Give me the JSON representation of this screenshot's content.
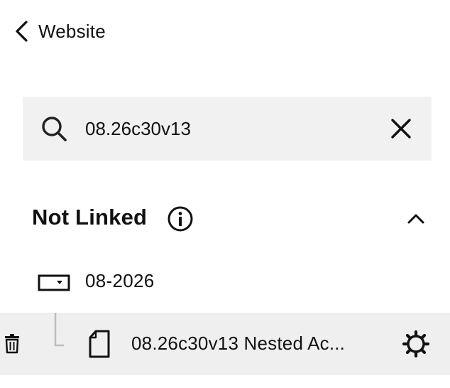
{
  "header": {
    "back_label": "Website"
  },
  "search": {
    "value": "08.26c30v13"
  },
  "section": {
    "title": "Not Linked"
  },
  "tree": {
    "folder": {
      "label": "08-2026"
    },
    "page": {
      "label": "08.26c30v13 Nested Ac..."
    }
  },
  "icons": {
    "back": "chevron-left-icon",
    "search": "search-icon",
    "clear": "close-icon",
    "info": "info-icon",
    "collapse": "chevron-up-icon",
    "folder": "folder-dropdown-icon",
    "delete": "trash-icon",
    "page": "page-icon",
    "settings": "gear-icon"
  },
  "colors": {
    "text": "#111111",
    "search_background": "#f1f1f1",
    "selected_row": "#efefef",
    "tree_line": "#bdbdbd"
  }
}
